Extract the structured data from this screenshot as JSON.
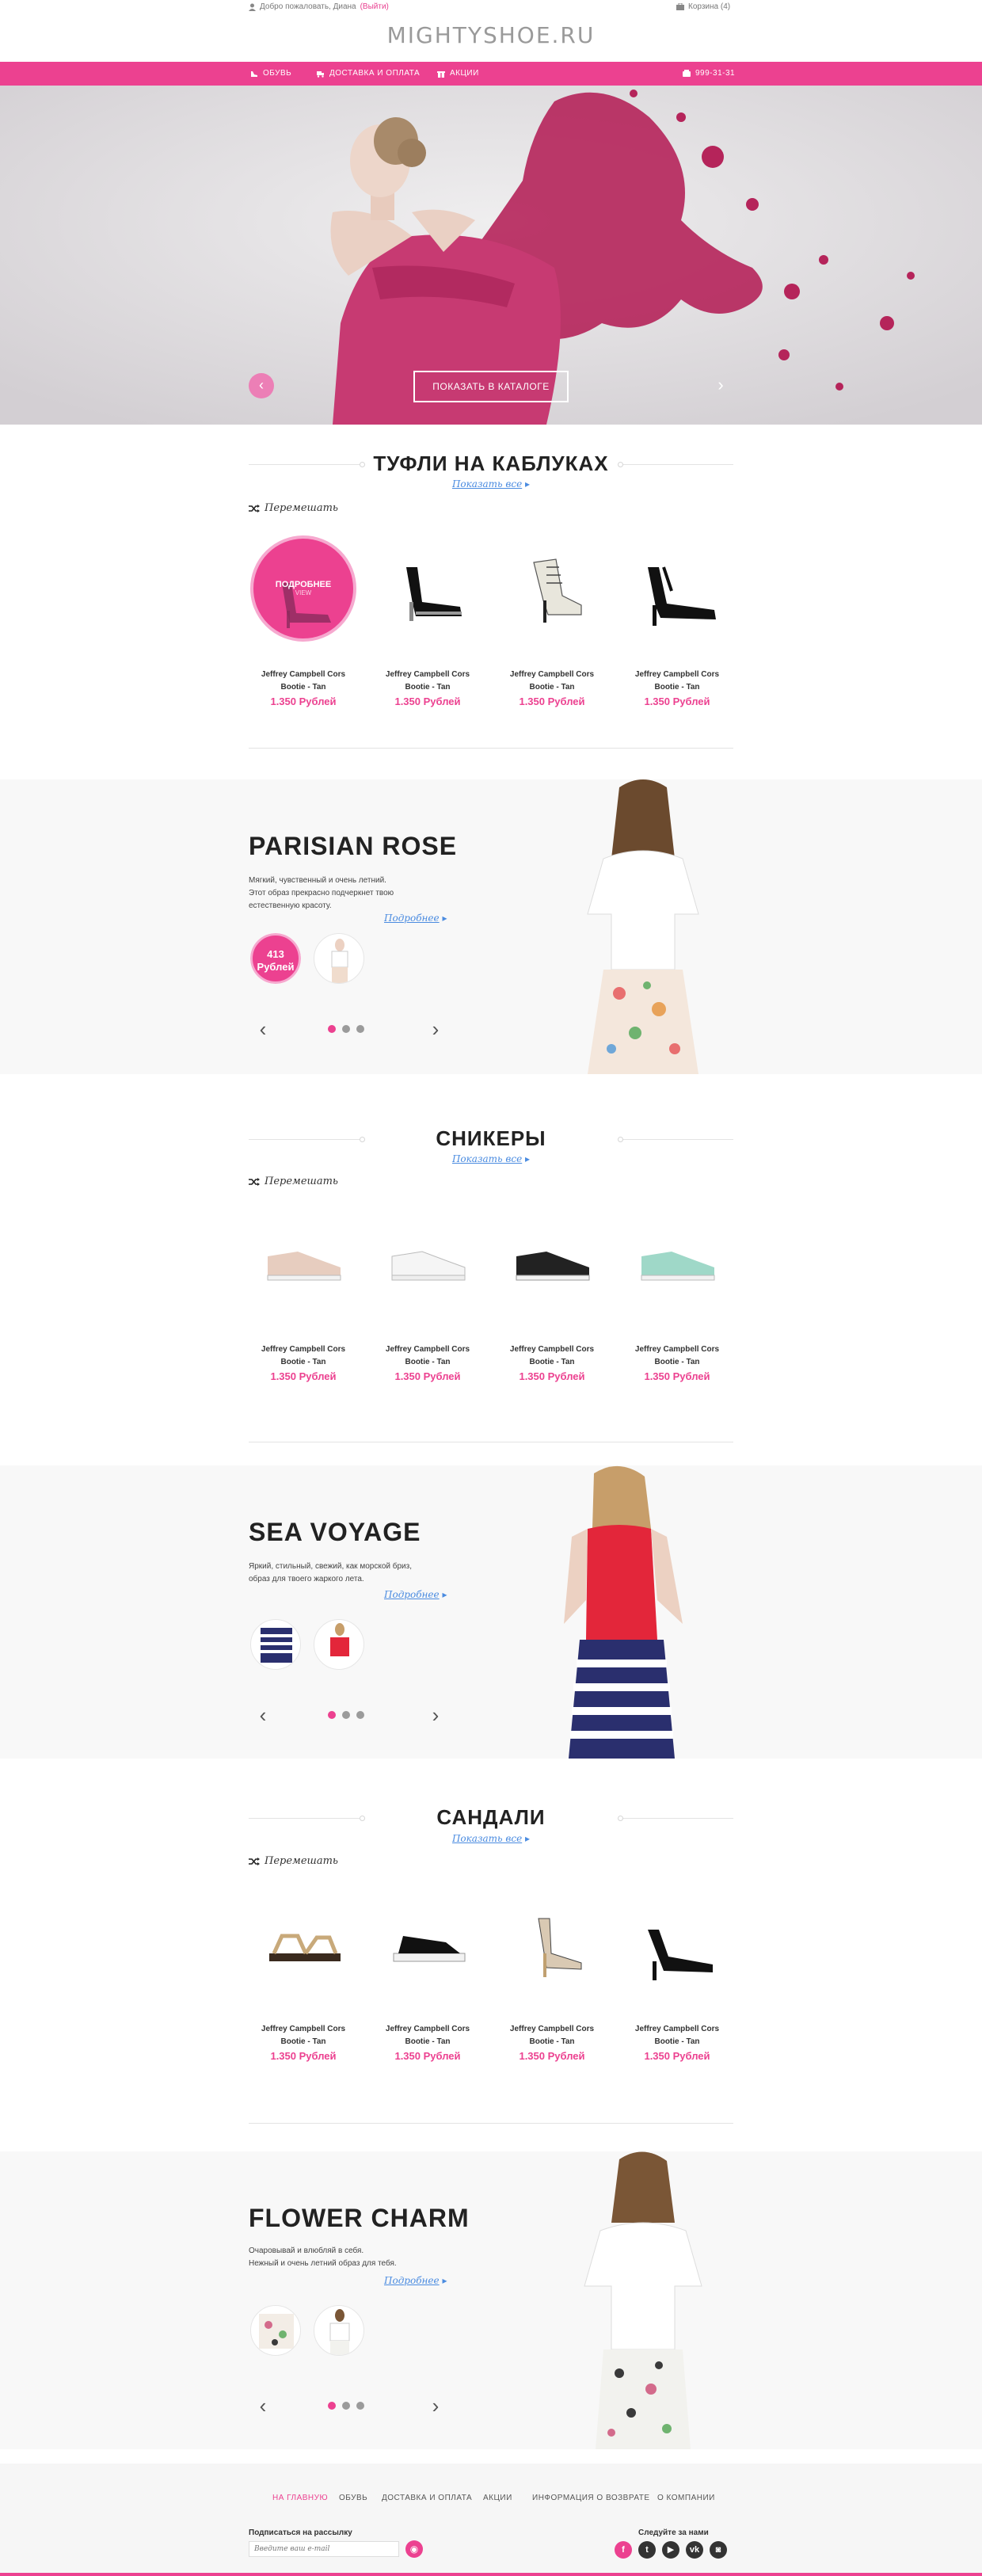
{
  "topbar": {
    "welcome_text": "Добро пожаловать, Диана",
    "logout_label": "(Выйти)",
    "cart_label": "Корзина (4)",
    "logo": "MIGHTYSHOE.RU"
  },
  "nav": {
    "items": [
      "ОБУВЬ",
      "ДОСТАВКА И ОПЛАТА",
      "АКЦИИ"
    ],
    "phone": "999-31-31"
  },
  "hero": {
    "button_label": "ПОКАЗАТЬ В КАТАЛОГЕ",
    "prev_glyph": "‹",
    "next_glyph": "›"
  },
  "sections": [
    {
      "title": "ТУФЛИ НА КАБЛУКАХ",
      "show_all": "Показать все",
      "shuffle": "Перемешать",
      "hover_label": "ПОДРОБНЕЕ",
      "products": [
        {
          "name_line1": "Jeffrey Campbell Cors",
          "name_line2": "Bootie - Tan",
          "price": "1.350 Рублей"
        },
        {
          "name_line1": "Jeffrey Campbell Cors",
          "name_line2": "Bootie - Tan",
          "price": "1.350 Рублей"
        },
        {
          "name_line1": "Jeffrey Campbell Cors",
          "name_line2": "Bootie - Tan",
          "price": "1.350 Рублей"
        },
        {
          "name_line1": "Jeffrey Campbell Cors",
          "name_line2": "Bootie - Tan",
          "price": "1.350 Рублей"
        }
      ]
    },
    {
      "title": "СНИКЕРЫ",
      "show_all": "Показать все",
      "shuffle": "Перемешать",
      "products": [
        {
          "name_line1": "Jeffrey Campbell Cors",
          "name_line2": "Bootie - Tan",
          "price": "1.350 Рублей"
        },
        {
          "name_line1": "Jeffrey Campbell Cors",
          "name_line2": "Bootie - Tan",
          "price": "1.350 Рублей"
        },
        {
          "name_line1": "Jeffrey Campbell Cors",
          "name_line2": "Bootie - Tan",
          "price": "1.350 Рублей"
        },
        {
          "name_line1": "Jeffrey Campbell Cors",
          "name_line2": "Bootie - Tan",
          "price": "1.350 Рублей"
        }
      ]
    },
    {
      "title": "САНДАЛИ",
      "show_all": "Показать все",
      "shuffle": "Перемешать",
      "products": [
        {
          "name_line1": "Jeffrey Campbell Cors",
          "name_line2": "Bootie - Tan",
          "price": "1.350 Рублей"
        },
        {
          "name_line1": "Jeffrey Campbell Cors",
          "name_line2": "Bootie - Tan",
          "price": "1.350 Рублей"
        },
        {
          "name_line1": "Jeffrey Campbell Cors",
          "name_line2": "Bootie - Tan",
          "price": "1.350 Рублей"
        },
        {
          "name_line1": "Jeffrey Campbell Cors",
          "name_line2": "Bootie - Tan",
          "price": "1.350 Рублей"
        }
      ]
    }
  ],
  "lookbooks": [
    {
      "title": "PARISIAN ROSE",
      "desc_line1": "Мягкий, чувственный и очень летний.",
      "desc_line2": "Этот образ прекрасно подчеркнет твою",
      "desc_line3": "естественную красоту.",
      "more": "Подробнее",
      "thumb_price_line1": "413",
      "thumb_price_line2": "Рублей"
    },
    {
      "title": "SEA VOYAGE",
      "desc_line1": "Яркий, стильный, свежий, как морской бриз,",
      "desc_line2": "образ для твоего жаркого лета.",
      "desc_line3": "",
      "more": "Подробнее"
    },
    {
      "title": "FLOWER CHARM",
      "desc_line1": "Очаровывай и влюбляй в себя.",
      "desc_line2": "Нежный и очень летний образ для тебя.",
      "desc_line3": "",
      "more": "Подробнее"
    }
  ],
  "footer": {
    "nav": [
      "НА ГЛАВНУЮ",
      "ОБУВЬ",
      "ДОСТАВКА И ОПЛАТА",
      "АКЦИИ",
      "ИНФОРМАЦИЯ О ВОЗВРАТЕ",
      "О КОМПАНИИ"
    ],
    "subscribe_label": "Подписаться на рассылку",
    "subscribe_placeholder": "Введите ваш e-mail",
    "follow_label": "Следуйте за нами",
    "social": [
      {
        "icon": "facebook-icon",
        "glyph": "f",
        "color": "#ec4190"
      },
      {
        "icon": "twitter-icon",
        "glyph": "t",
        "color": "#333333"
      },
      {
        "icon": "youtube-icon",
        "glyph": "▶",
        "color": "#333333"
      },
      {
        "icon": "vk-icon",
        "glyph": "vk",
        "color": "#333333"
      },
      {
        "icon": "instagram-icon",
        "glyph": "◙",
        "color": "#333333"
      }
    ]
  },
  "colors": {
    "accent": "#ec4190",
    "link": "#4a8be0",
    "panel_bg": "#f8f8f8"
  }
}
